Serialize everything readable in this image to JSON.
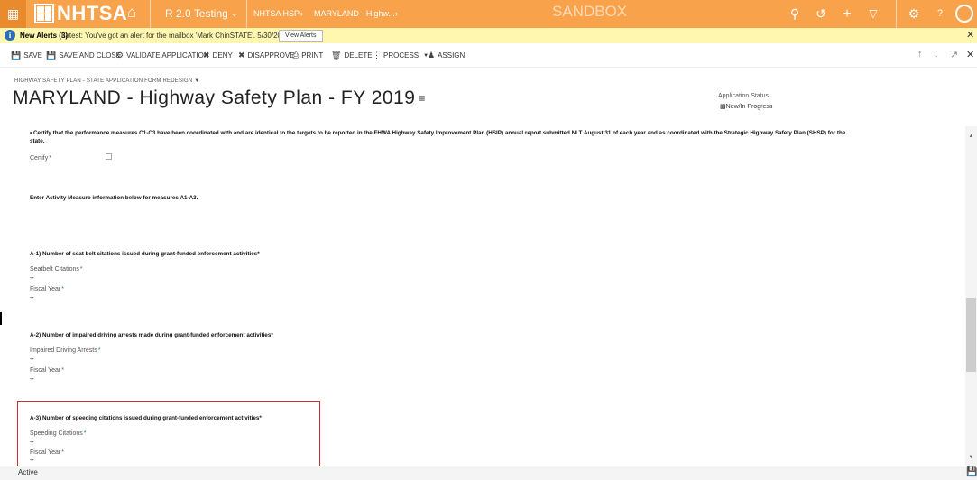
{
  "topbar": {
    "logo_text": "NHTSA",
    "environment": "R 2.0 Testing",
    "nav_hsp": "NHTSA HSP",
    "nav_record": "MARYLAND - Highw...",
    "sandbox_label": "SANDBOX",
    "icons": [
      "apps-icon",
      "home-icon",
      "chevron-down-icon",
      "chevron-right-icon",
      "search-icon",
      "history-icon",
      "plus-icon",
      "filter-icon",
      "gear-icon",
      "help-icon",
      "user-avatar-icon"
    ]
  },
  "alert": {
    "title": "New Alerts (3)",
    "message": "Latest: You've got an alert for the mailbox 'Mark ChinSTATE'. 5/30/2017 9:50 AM",
    "button": "View Alerts",
    "icon": "info-icon"
  },
  "commands": {
    "save": "SAVE",
    "save_close": "SAVE AND CLOSE",
    "validate": "VALIDATE APPLICATION",
    "deny": "DENY",
    "disapprove": "DISAPPROVE",
    "print": "PRINT",
    "delete": "DELETE",
    "process": "PROCESS",
    "assign": "ASSIGN"
  },
  "form": {
    "form_selector": "HIGHWAY SAFETY PLAN - STATE APPLICATION FORM REDESIGN",
    "title": "MARYLAND - Highway Safety Plan - FY 2019",
    "status_label": "Application Status",
    "status_value": "New/In Progress"
  },
  "content": {
    "certify_heading": "• Certify that the performance measures C1-C3 have been coordinated with and are identical to the targets to be reported in the FHWA Highway Safety Improvement Plan (HSIP) annual report submitted NLT August 31 of each year and as coordinated with the Strategic Highway Safety Plan (SHSP) for the",
    "certify_heading_cont": "state.",
    "certify_label": "Certify",
    "activity_intro": "Enter Activity Measure information below for measures A1-A3.",
    "a1_heading": "A-1) Number of seat belt citations issued during grant-funded enforcement activities*",
    "a1_field1_label": "Seatbelt Citations",
    "a1_field1_value": "--",
    "a1_field2_label": "Fiscal Year",
    "a1_field2_value": "--",
    "a2_heading": "A-2) Number of impaired driving arrests made during grant-funded enforcement activities*",
    "a2_field1_label": "Impaired Driving Arrests",
    "a2_field1_value": "--",
    "a2_field2_label": "Fiscal Year",
    "a2_field2_value": "--",
    "a3_heading": "A-3) Number of speeding citations issued during grant-funded enforcement activities*",
    "a3_field1_label": "Speeding Citations",
    "a3_field1_value": "--",
    "a3_field2_label": "Fiscal Year",
    "a3_field2_value": "--",
    "required_mark": "*"
  },
  "statusbar": {
    "state": "Active"
  },
  "colors": {
    "topbar": "#f8a24b",
    "alertbar": "#fff7b0",
    "highlight": "#d62828",
    "required": "#2a6cb5"
  }
}
